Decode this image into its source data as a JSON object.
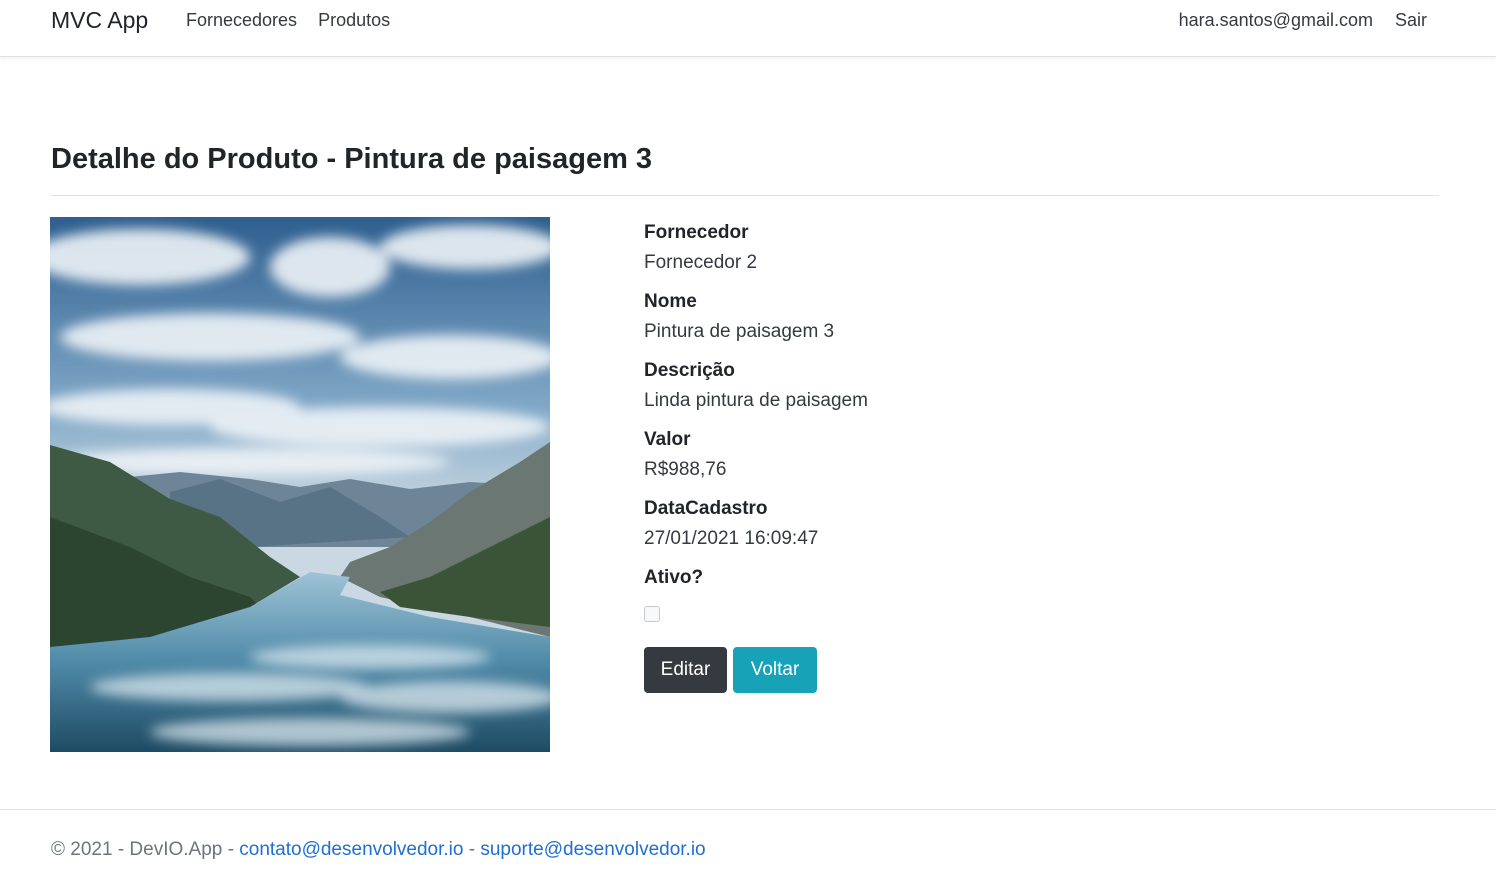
{
  "navbar": {
    "brand": "MVC App",
    "left_links": [
      "Fornecedores",
      "Produtos"
    ],
    "user_email": "hara.santos@gmail.com",
    "logout": "Sair"
  },
  "page": {
    "title": "Detalhe do Produto - Pintura de paisagem 3"
  },
  "product": {
    "image_icon": "landscape-photo",
    "fields": [
      {
        "label": "Fornecedor",
        "value": "Fornecedor 2"
      },
      {
        "label": "Nome",
        "value": "Pintura de paisagem 3"
      },
      {
        "label": "Descrição",
        "value": "Linda pintura de paisagem"
      },
      {
        "label": "Valor",
        "value": "R$988,76"
      },
      {
        "label": "DataCadastro",
        "value": "27/01/2021 16:09:47"
      }
    ],
    "active_label": "Ativo?",
    "active_checked": false
  },
  "actions": {
    "edit": "Editar",
    "back": "Voltar"
  },
  "footer": {
    "prefix": "© 2021 - DevIO.App - ",
    "contact_email": "contato@desenvolvedor.io",
    "separator": " - ",
    "support_email": "suporte@desenvolvedor.io"
  },
  "colors": {
    "btn_dark": "#343a40",
    "btn_info": "#17a2b8",
    "link": "#1f6fd1"
  }
}
